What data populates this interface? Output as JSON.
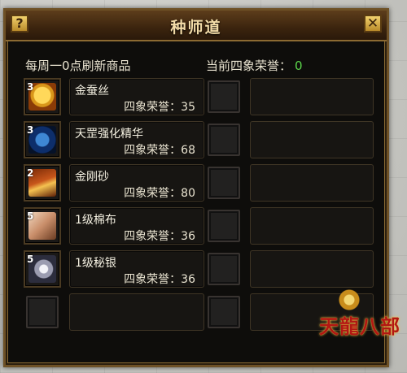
{
  "window": {
    "title": "种师道",
    "help_label": "?",
    "close_label": "✕"
  },
  "header": {
    "refresh_note": "每周一0点刷新商品",
    "honor_label": "当前四象荣誉：",
    "honor_value": "0"
  },
  "items": [
    {
      "name": "金蚕丝",
      "cost": "四象荣誉：35",
      "qty": "3",
      "icon": "golden-silk-icon"
    },
    {
      "name": "天罡强化精华",
      "cost": "四象荣誉：68",
      "qty": "3",
      "icon": "enhance-essence-icon"
    },
    {
      "name": "金刚砂",
      "cost": "四象荣誉：80",
      "qty": "2",
      "icon": "diamond-sand-icon"
    },
    {
      "name": "1级棉布",
      "cost": "四象荣誉：36",
      "qty": "5",
      "icon": "cotton-cloth-icon"
    },
    {
      "name": "1级秘银",
      "cost": "四象荣誉：36",
      "qty": "5",
      "icon": "mithril-icon"
    }
  ],
  "logo": {
    "text": "天龍八部"
  },
  "colors": {
    "honor_value": "#5bd54b",
    "title": "#f3dca8",
    "frame": "#6e5126"
  }
}
